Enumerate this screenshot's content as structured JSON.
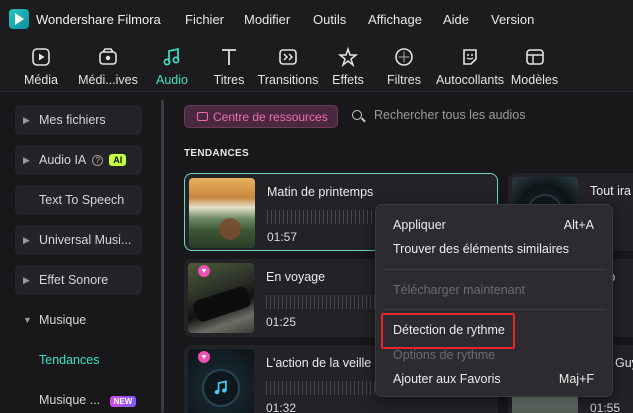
{
  "app": {
    "title": "Wondershare Filmora"
  },
  "menu": [
    "Fichier",
    "Modifier",
    "Outils",
    "Affichage",
    "Aide",
    "Version"
  ],
  "toolbar": [
    {
      "label": "Média",
      "icon": "media-icon"
    },
    {
      "label": "Médi...ives",
      "icon": "stock-media-icon"
    },
    {
      "label": "Audio",
      "icon": "music-note-icon",
      "active": true
    },
    {
      "label": "Titres",
      "icon": "text-icon"
    },
    {
      "label": "Transitions",
      "icon": "transition-icon"
    },
    {
      "label": "Effets",
      "icon": "effects-icon"
    },
    {
      "label": "Filtres",
      "icon": "filter-icon"
    },
    {
      "label": "Autocollants",
      "icon": "sticker-icon"
    },
    {
      "label": "Modèles",
      "icon": "template-icon"
    }
  ],
  "sidebar": {
    "items": [
      {
        "label": "Mes fichiers"
      },
      {
        "label": "Audio IA",
        "badge": "AI"
      },
      {
        "label": "Text To Speech"
      },
      {
        "label": "Universal Musi..."
      },
      {
        "label": "Effet Sonore"
      },
      {
        "label": "Musique"
      }
    ],
    "subitems": [
      {
        "label": "Tendances",
        "active": true
      },
      {
        "label": "Musique ...",
        "badge": "NEW"
      }
    ]
  },
  "main": {
    "resource_button": "Centre de ressources",
    "search_placeholder": "Rechercher tous les audios",
    "section_title": "TENDANCES",
    "cards": [
      {
        "title": "Matin de printemps",
        "duration": "01:57"
      },
      {
        "title": "Tout ira m",
        "duration": ""
      },
      {
        "title": "En voyage",
        "duration": "01:25"
      },
      {
        "title": "re-p",
        "duration": ""
      },
      {
        "title": "L'action de la veille d",
        "duration": "01:32"
      },
      {
        "title": "Guy",
        "duration": "01:55"
      }
    ]
  },
  "context_menu": {
    "items": [
      {
        "label": "Appliquer",
        "shortcut": "Alt+A"
      },
      {
        "label": "Trouver des éléments similaires"
      },
      {
        "label": "Télécharger maintenant",
        "disabled": true
      },
      {
        "label": "Détection de rythme"
      },
      {
        "label": "Options de rythme",
        "disabled": true
      },
      {
        "label": "Ajouter aux Favoris",
        "shortcut": "Maj+F"
      }
    ]
  },
  "colors": {
    "accent": "#3fe0c5",
    "highlight_box": "#e4262b",
    "resource_pink": "#f16bb0"
  }
}
